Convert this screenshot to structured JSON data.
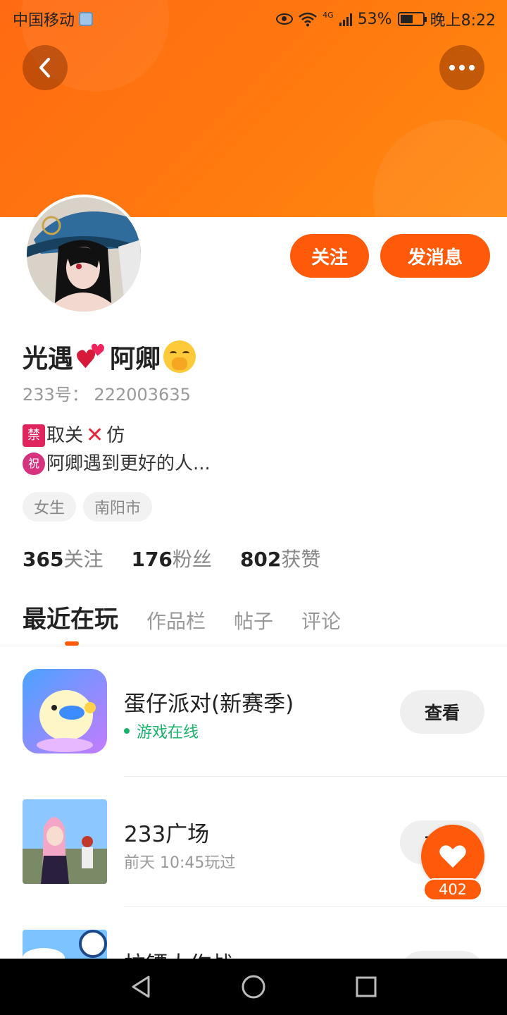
{
  "status_bar": {
    "carrier": "中国移动",
    "network": "4G",
    "battery": "53%",
    "time": "晚上8:22"
  },
  "profile": {
    "name_part1": "光遇",
    "name_part2": "阿卿",
    "user_id": "233号：  222003635",
    "bio_line1": "取关",
    "bio_line1_end": "仿",
    "bio_line2": "阿卿遇到更好的人...",
    "ban_badge": "禁",
    "bless_badge": "祝",
    "tags": [
      "女生",
      "南阳市"
    ],
    "following_count": "365",
    "following_label": "关注",
    "followers_count": "176",
    "followers_label": "粉丝",
    "likes_count": "802",
    "likes_label": "获赞"
  },
  "actions": {
    "follow_label": "关注",
    "message_label": "发消息"
  },
  "tabs": [
    {
      "label": "最近在玩",
      "active": true
    },
    {
      "label": "作品栏",
      "active": false
    },
    {
      "label": "帖子",
      "active": false
    },
    {
      "label": "评论",
      "active": false
    }
  ],
  "games": [
    {
      "title": "蛋仔派对(新赛季)",
      "status": "游戏在线",
      "button": "查看"
    },
    {
      "title": "233广场",
      "status": "前天 10:45玩过",
      "button": "查看"
    },
    {
      "title": "拉镖大作战",
      "status": "",
      "button": "查看"
    }
  ],
  "like_fab": {
    "count": "402"
  },
  "colors": {
    "accent": "#ff5a0a",
    "banner": "#ff7a0f",
    "online": "#19b36b"
  }
}
